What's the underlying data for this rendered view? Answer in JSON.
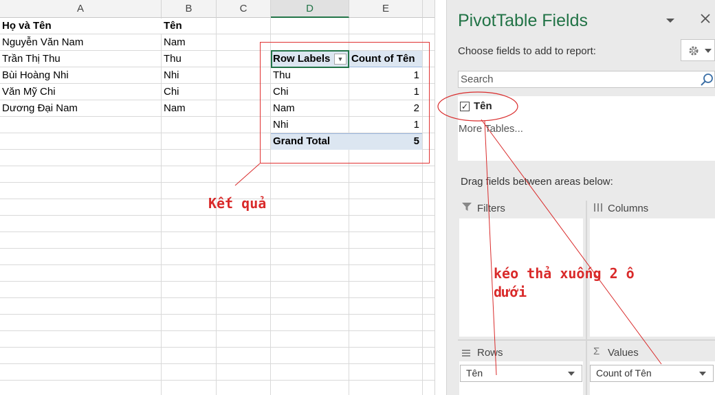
{
  "sheet": {
    "columns": [
      "A",
      "B",
      "C",
      "D",
      "E"
    ],
    "selected_column": "D",
    "header_row": {
      "name": "Họ và Tên",
      "short": "Tên"
    },
    "rows": [
      {
        "name": "Nguyễn Văn Nam",
        "short": "Nam"
      },
      {
        "name": "Trần Thị Thu",
        "short": "Thu"
      },
      {
        "name": "Bùi Hoàng Nhi",
        "short": "Nhi"
      },
      {
        "name": "Văn Mỹ Chi",
        "short": "Chi"
      },
      {
        "name": "Dương Đại Nam",
        "short": "Nam"
      }
    ]
  },
  "pivot": {
    "row_labels_header": "Row Labels",
    "count_header": "Count of Tên",
    "rows": [
      {
        "label": "Thu",
        "count": "1"
      },
      {
        "label": "Chi",
        "count": "1"
      },
      {
        "label": "Nam",
        "count": "2"
      },
      {
        "label": "Nhi",
        "count": "1"
      }
    ],
    "grand_total_label": "Grand Total",
    "grand_total_value": "5"
  },
  "annotations": {
    "result": "Kết quả",
    "drag_line1": "kéo thả xuống 2 ô",
    "drag_line2": "dưới"
  },
  "pane": {
    "title": "PivotTable Fields",
    "choose_label": "Choose fields to add to report:",
    "search_placeholder": "Search",
    "field_name": "Tên",
    "field_checked": true,
    "more_tables": "More Tables...",
    "drag_label": "Drag fields between areas below:",
    "areas": {
      "filters": "Filters",
      "columns": "Columns",
      "rows": "Rows",
      "values": "Values"
    },
    "rows_field": "Tên",
    "values_field": "Count of Tên"
  },
  "icons": {
    "dropdown": "chevron-down-icon",
    "close": "close-icon",
    "gear": "gear-icon",
    "search": "search-icon",
    "filter": "filter-icon",
    "columns": "columns-icon",
    "rows": "rows-icon",
    "sigma": "sigma-icon"
  },
  "colors": {
    "accent": "#217346",
    "annotation": "#d92a2a",
    "pivot_header": "#dce6f1"
  }
}
